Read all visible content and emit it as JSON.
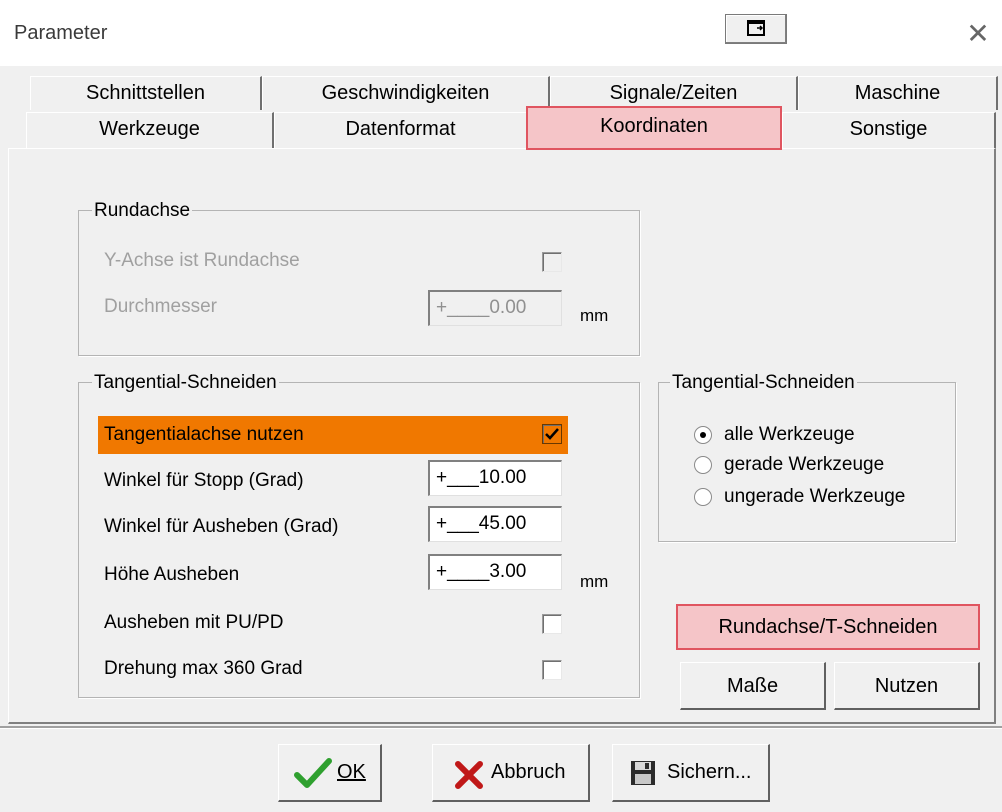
{
  "window": {
    "title": "Parameter"
  },
  "tabs": {
    "row1": [
      {
        "label": "Schnittstellen"
      },
      {
        "label": "Geschwindigkeiten"
      },
      {
        "label": "Signale/Zeiten"
      },
      {
        "label": "Maschine"
      }
    ],
    "row2": [
      {
        "label": "Werkzeuge"
      },
      {
        "label": "Datenformat"
      },
      {
        "label": "Koordinaten",
        "active": true
      },
      {
        "label": "Sonstige"
      }
    ]
  },
  "rundachse": {
    "title": "Rundachse",
    "y_achse_label": "Y-Achse ist Rundachse",
    "y_achse_checked": false,
    "durchmesser_label": "Durchmesser",
    "durchmesser_value": "+____0.00",
    "durchmesser_unit": "mm"
  },
  "tangential": {
    "title": "Tangential-Schneiden",
    "nutzen_label": "Tangentialachse nutzen",
    "nutzen_checked": true,
    "stopp_label": "Winkel für Stopp (Grad)",
    "stopp_value": "+___10.00",
    "ausheben_label": "Winkel für Ausheben (Grad)",
    "ausheben_value": "+___45.00",
    "hoehe_label": "Höhe Ausheben",
    "hoehe_value": "+____3.00",
    "hoehe_unit": "mm",
    "pupd_label": "Ausheben mit PU/PD",
    "pupd_checked": false,
    "drehung_label": "Drehung max 360 Grad",
    "drehung_checked": false
  },
  "tangential_tools": {
    "title": "Tangential-Schneiden",
    "options": [
      {
        "label": "alle Werkzeuge",
        "selected": true
      },
      {
        "label": "gerade Werkzeuge",
        "selected": false
      },
      {
        "label": "ungerade Werkzeuge",
        "selected": false
      }
    ]
  },
  "side_buttons": {
    "rundachse_t": "Rundachse/T-Schneiden",
    "masse": "Maße",
    "nutzen": "Nutzen"
  },
  "footer": {
    "ok_label": "OK",
    "abbruch_label": "Abbruch",
    "sichern_label": "Sichern..."
  },
  "colors": {
    "highlight_row": "#f07800",
    "tab_active_bg": "#f5c5c8",
    "tab_active_border": "#e05560",
    "ok_check": "#2fa02f",
    "cancel_x": "#c01818"
  },
  "icons": {
    "ok": "check-icon",
    "abbruch": "x-icon",
    "sichern": "floppy-disk-icon",
    "restore": "restore-window-icon",
    "close": "close-icon"
  }
}
